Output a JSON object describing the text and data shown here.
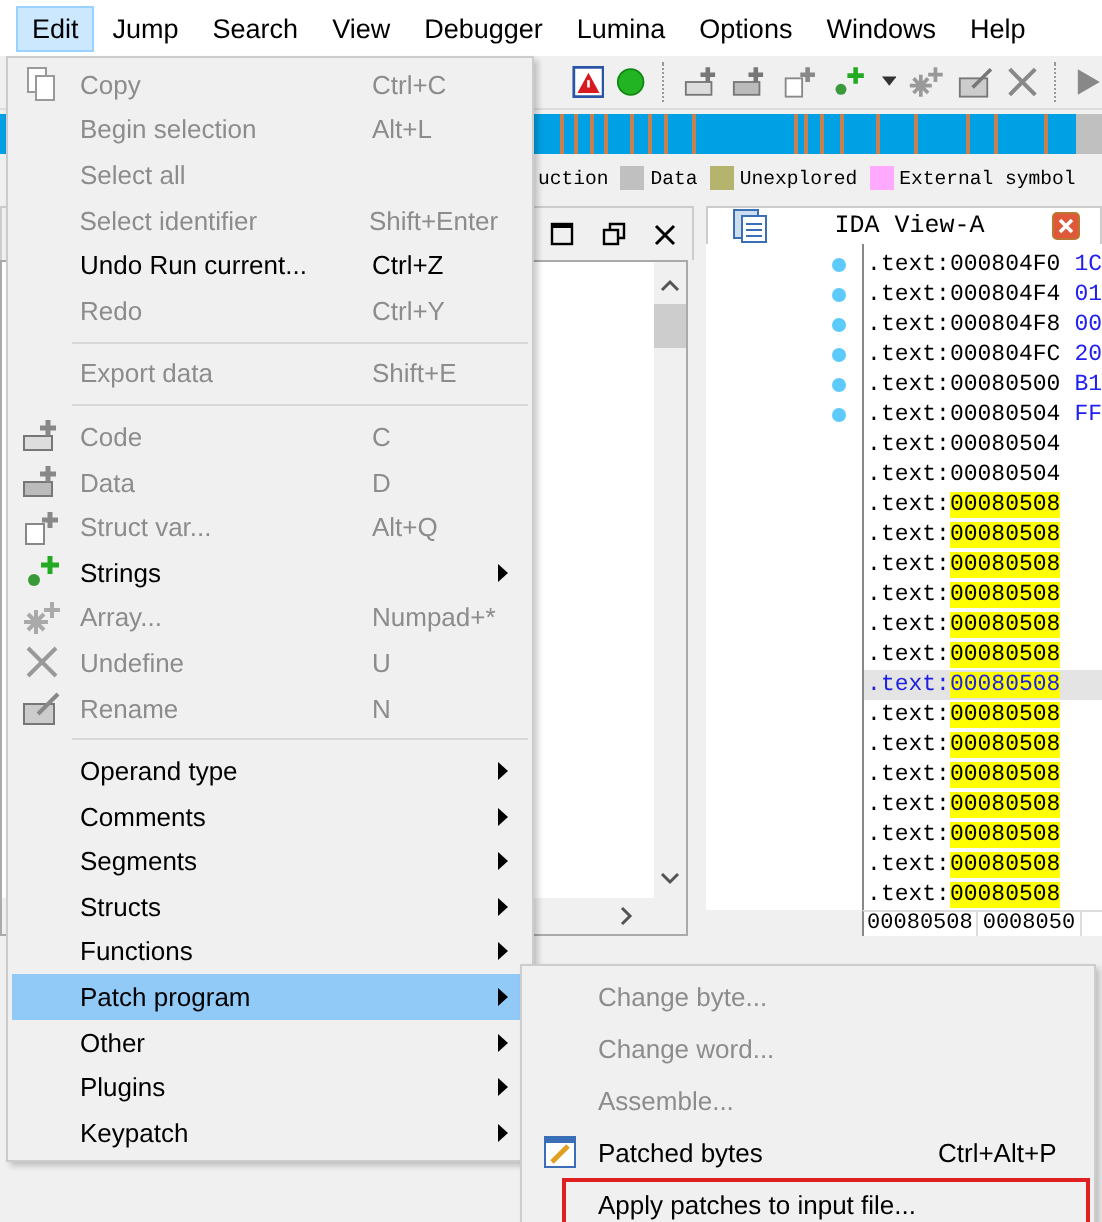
{
  "menubar": [
    {
      "label": "Edit",
      "selected": true
    },
    {
      "label": "Jump",
      "selected": false
    },
    {
      "label": "Search",
      "selected": false
    },
    {
      "label": "View",
      "selected": false
    },
    {
      "label": "Debugger",
      "selected": false
    },
    {
      "label": "Lumina",
      "selected": false
    },
    {
      "label": "Options",
      "selected": false
    },
    {
      "label": "Windows",
      "selected": false
    },
    {
      "label": "Help",
      "selected": false
    }
  ],
  "legend": [
    {
      "label": "uction"
    },
    {
      "label": "Data",
      "color": "#c0c0c0"
    },
    {
      "label": "Unexplored",
      "color": "#b4b46e"
    },
    {
      "label": "External symbol",
      "color": "#ffaaff"
    }
  ],
  "ida_view": {
    "title": "IDA View-A",
    "lines": [
      {
        "segment": ".text:",
        "address": "000804F0",
        "value": "1C",
        "bullet": true,
        "highlighted": false,
        "selected": false
      },
      {
        "segment": ".text:",
        "address": "000804F4",
        "value": "01",
        "bullet": true,
        "highlighted": false,
        "selected": false
      },
      {
        "segment": ".text:",
        "address": "000804F8",
        "value": "00",
        "bullet": true,
        "highlighted": false,
        "selected": false
      },
      {
        "segment": ".text:",
        "address": "000804FC",
        "value": "20",
        "bullet": true,
        "highlighted": false,
        "selected": false
      },
      {
        "segment": ".text:",
        "address": "00080500",
        "value": "B1",
        "bullet": true,
        "highlighted": false,
        "selected": false
      },
      {
        "segment": ".text:",
        "address": "00080504",
        "value": "FF",
        "bullet": true,
        "highlighted": false,
        "selected": false
      },
      {
        "segment": ".text:",
        "address": "00080504",
        "bullet": false,
        "highlighted": false,
        "selected": false
      },
      {
        "segment": ".text:",
        "address": "00080504",
        "bullet": false,
        "highlighted": false,
        "selected": false
      },
      {
        "segment": ".text:",
        "address": "00080508",
        "bullet": false,
        "highlighted": true,
        "selected": false
      },
      {
        "segment": ".text:",
        "address": "00080508",
        "bullet": false,
        "highlighted": true,
        "selected": false
      },
      {
        "segment": ".text:",
        "address": "00080508",
        "bullet": false,
        "highlighted": true,
        "selected": false
      },
      {
        "segment": ".text:",
        "address": "00080508",
        "bullet": false,
        "highlighted": true,
        "selected": false
      },
      {
        "segment": ".text:",
        "address": "00080508",
        "bullet": false,
        "highlighted": true,
        "selected": false
      },
      {
        "segment": ".text:",
        "address": "00080508",
        "bullet": false,
        "highlighted": true,
        "selected": false
      },
      {
        "segment": ".text:",
        "address": "00080508",
        "bullet": false,
        "highlighted": true,
        "selected": true
      },
      {
        "segment": ".text:",
        "address": "00080508",
        "bullet": false,
        "highlighted": true,
        "selected": false
      },
      {
        "segment": ".text:",
        "address": "00080508",
        "bullet": false,
        "highlighted": true,
        "selected": false
      },
      {
        "segment": ".text:",
        "address": "00080508",
        "bullet": false,
        "highlighted": true,
        "selected": false
      },
      {
        "segment": ".text:",
        "address": "00080508",
        "bullet": false,
        "highlighted": true,
        "selected": false
      },
      {
        "segment": ".text:",
        "address": "00080508",
        "bullet": false,
        "highlighted": true,
        "selected": false
      },
      {
        "segment": ".text:",
        "address": "00080508",
        "bullet": false,
        "highlighted": true,
        "selected": false
      },
      {
        "segment": ".text:",
        "address": "00080508",
        "bullet": false,
        "highlighted": true,
        "selected": false
      }
    ],
    "status": [
      "00080508",
      "0008050"
    ]
  },
  "edit_menu": [
    {
      "kind": "item",
      "label": "Copy",
      "shortcut": "Ctrl+C",
      "disabled": true
    },
    {
      "kind": "item",
      "label": "Begin selection",
      "shortcut": "Alt+L",
      "disabled": true
    },
    {
      "kind": "item",
      "label": "Select all",
      "disabled": true
    },
    {
      "kind": "item",
      "label": "Select identifier",
      "shortcut": "Shift+Enter",
      "disabled": true
    },
    {
      "kind": "item",
      "label": "Undo Run current...",
      "shortcut": "Ctrl+Z",
      "disabled": false
    },
    {
      "kind": "item",
      "label": "Redo",
      "shortcut": "Ctrl+Y",
      "disabled": true
    },
    {
      "kind": "separator"
    },
    {
      "kind": "item",
      "label": "Export data",
      "shortcut": "Shift+E",
      "disabled": true
    },
    {
      "kind": "separator"
    },
    {
      "kind": "item",
      "label": "Code",
      "shortcut": "C",
      "disabled": true
    },
    {
      "kind": "item",
      "label": "Data",
      "shortcut": "D",
      "disabled": true
    },
    {
      "kind": "item",
      "label": "Struct var...",
      "shortcut": "Alt+Q",
      "disabled": true
    },
    {
      "kind": "submenu",
      "label": "Strings",
      "disabled": false,
      "selected": false
    },
    {
      "kind": "item",
      "label": "Array...",
      "shortcut": "Numpad+*",
      "disabled": true
    },
    {
      "kind": "item",
      "label": "Undefine",
      "shortcut": "U",
      "disabled": true
    },
    {
      "kind": "item",
      "label": "Rename",
      "shortcut": "N",
      "disabled": true
    },
    {
      "kind": "separator"
    },
    {
      "kind": "submenu",
      "label": "Operand type",
      "disabled": false,
      "selected": false
    },
    {
      "kind": "submenu",
      "label": "Comments",
      "disabled": false,
      "selected": false
    },
    {
      "kind": "submenu",
      "label": "Segments",
      "disabled": false,
      "selected": false
    },
    {
      "kind": "submenu",
      "label": "Structs",
      "disabled": false,
      "selected": false
    },
    {
      "kind": "submenu",
      "label": "Functions",
      "disabled": false,
      "selected": false
    },
    {
      "kind": "submenu",
      "label": "Patch program",
      "disabled": false,
      "selected": true
    },
    {
      "kind": "submenu",
      "label": "Other",
      "disabled": false,
      "selected": false
    },
    {
      "kind": "submenu",
      "label": "Plugins",
      "disabled": false,
      "selected": false
    },
    {
      "kind": "submenu",
      "label": "Keypatch",
      "disabled": false,
      "selected": false
    }
  ],
  "patch_submenu": [
    {
      "label": "Change byte...",
      "disabled": true,
      "highlighted": false
    },
    {
      "label": "Change word...",
      "disabled": true,
      "highlighted": false
    },
    {
      "label": "Assemble...",
      "disabled": true,
      "highlighted": false
    },
    {
      "label": "Patched bytes",
      "shortcut": "Ctrl+Alt+P",
      "disabled": false,
      "highlighted": false
    },
    {
      "label": "Apply patches to input file...",
      "disabled": false,
      "highlighted": true
    }
  ]
}
